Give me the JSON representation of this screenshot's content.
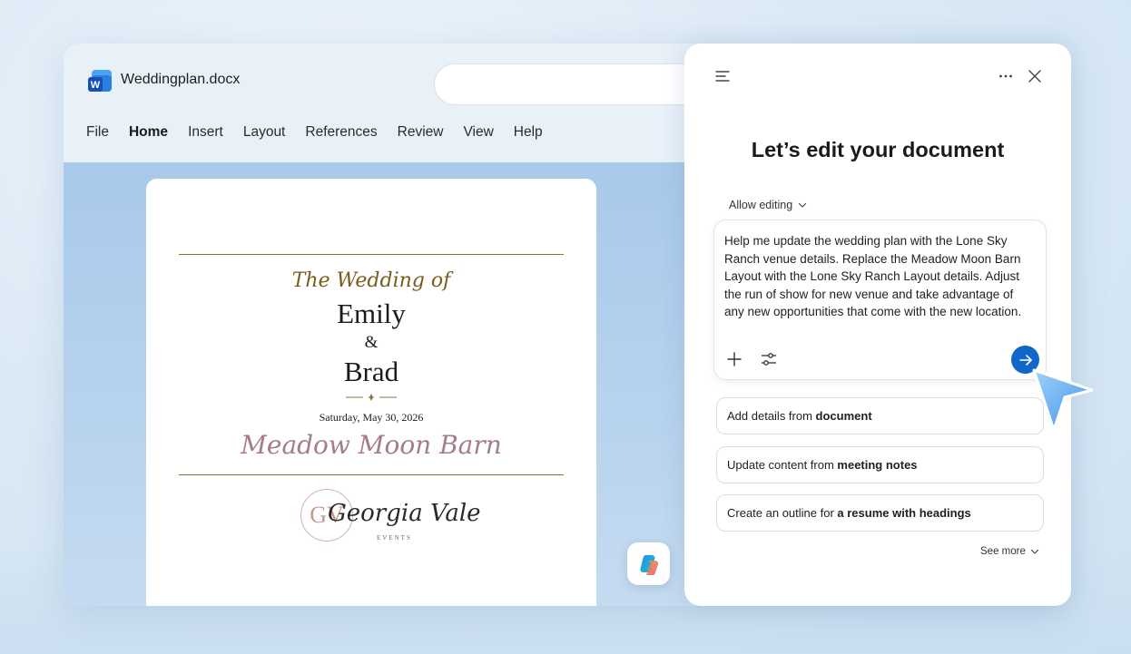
{
  "document": {
    "file_name": "Weddingplan.docx",
    "app_icon": "word-icon"
  },
  "menu": {
    "items": [
      "File",
      "Home",
      "Insert",
      "Layout",
      "References",
      "Review",
      "View",
      "Help"
    ],
    "active": "Home"
  },
  "page": {
    "heading": "The Wedding of",
    "partner_one": "Emily",
    "ampersand": "&",
    "partner_two": "Brad",
    "date": "Saturday, May 30, 2026",
    "venue": "Meadow Moon Barn",
    "logo": {
      "monogram": "GV",
      "name": "Georgia Vale",
      "subtitle": "EVENTS"
    }
  },
  "copilot": {
    "title": "Let’s edit your document",
    "allow_editing_label": "Allow editing",
    "prompt_text": "Help me update the wedding plan with the Lone Sky Ranch venue details. Replace the Meadow Moon Barn Layout with the Lone Sky Ranch Layout details. Adjust the run of show for new venue and take advantage of any new opportunities that come with the new location.",
    "suggestions": [
      {
        "prefix": "Add details from ",
        "bold": "document"
      },
      {
        "prefix": "Update content from ",
        "bold": "meeting notes"
      },
      {
        "prefix": "Create an outline for ",
        "bold": "a resume with headings"
      }
    ],
    "see_more_label": "See more"
  },
  "colors": {
    "accent_blue": "#1166c9",
    "gold": "#7a5c1a",
    "mauve": "#a57b8e"
  }
}
